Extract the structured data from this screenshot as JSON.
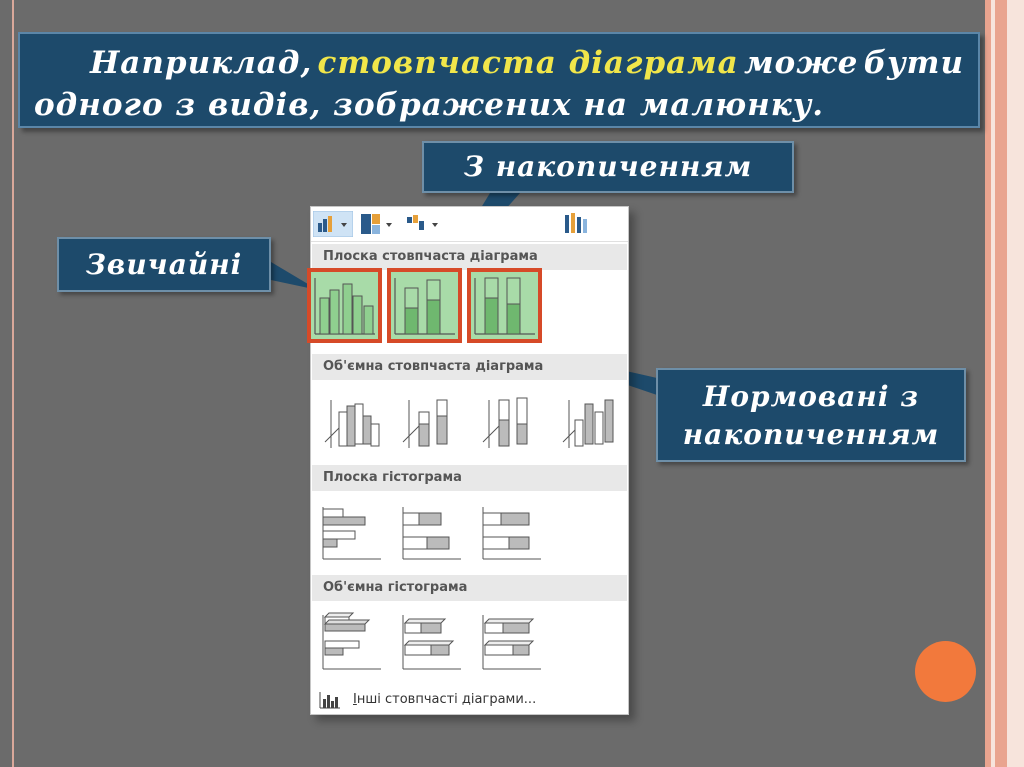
{
  "title": {
    "word1": "Наприклад,",
    "highlight": "стовпчаста діаграма",
    "word_after": "може",
    "word_last": "бути",
    "line2": "одного з видів, зображених на малюнку."
  },
  "callouts": {
    "stacked": "З накопиченням",
    "normal": "Звичайні",
    "percent_line1": "Нормовані з",
    "percent_line2": "накопиченням"
  },
  "gallery": {
    "sections": [
      {
        "label": "Плоска стовпчаста діаграма"
      },
      {
        "label": "Об'ємна стовпчаста діаграма"
      },
      {
        "label": "Плоска гістограма"
      },
      {
        "label": "Об'ємна гістограма"
      }
    ],
    "footer_first_letter": "І",
    "footer_rest": "нші стовпчасті діаграми..."
  },
  "colors": {
    "slide_bg": "#6b6b6b",
    "box_bg": "#1d4a6b",
    "highlight": "#f1e64a",
    "selection_border": "#d64a28",
    "selection_fill": "#a8dba8",
    "accent_dot": "#f2793c"
  }
}
